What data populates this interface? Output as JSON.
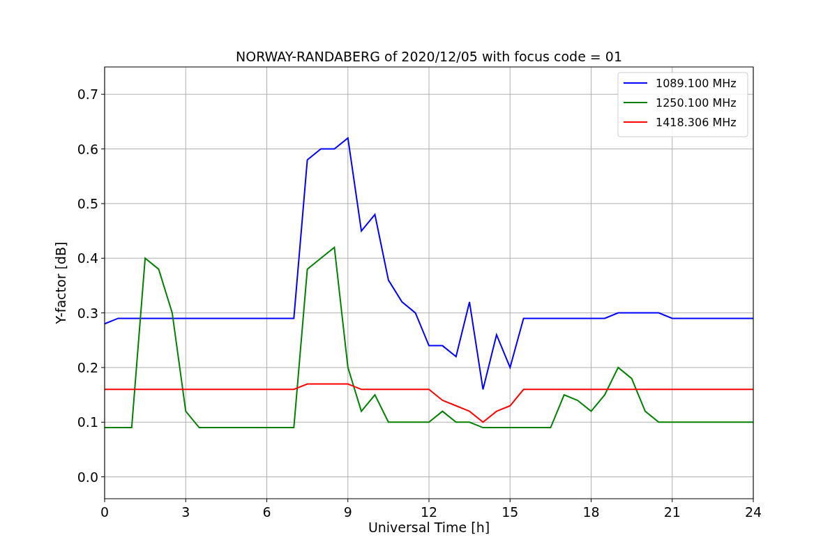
{
  "figure": {
    "chart_data": {
      "type": "line",
      "title": "NORWAY-RANDABERG of 2020/12/05 with focus code = 01",
      "xlabel": "Universal Time [h]",
      "ylabel": "Y-factor [dB]",
      "x": [
        0,
        0.5,
        1,
        1.5,
        2,
        2.5,
        3,
        3.5,
        4,
        4.5,
        5,
        5.5,
        6,
        6.5,
        7,
        7.5,
        8,
        8.5,
        9,
        9.5,
        10,
        10.5,
        11,
        11.5,
        12,
        12.5,
        13,
        13.5,
        14,
        14.5,
        15,
        15.5,
        16,
        16.5,
        17,
        17.5,
        18,
        18.5,
        19,
        19.5,
        20,
        20.5,
        21,
        21.5,
        22,
        22.5,
        23,
        23.5,
        24
      ],
      "series": [
        {
          "name": "1089.100 MHz",
          "color": "#0000ff",
          "values": [
            0.28,
            0.29,
            0.29,
            0.29,
            0.29,
            0.29,
            0.29,
            0.29,
            0.29,
            0.29,
            0.29,
            0.29,
            0.29,
            0.29,
            0.29,
            0.58,
            0.6,
            0.6,
            0.62,
            0.45,
            0.48,
            0.36,
            0.32,
            0.3,
            0.24,
            0.24,
            0.22,
            0.32,
            0.16,
            0.26,
            0.2,
            0.29,
            0.29,
            0.29,
            0.29,
            0.29,
            0.29,
            0.29,
            0.3,
            0.3,
            0.3,
            0.3,
            0.29,
            0.29,
            0.29,
            0.29,
            0.29,
            0.29,
            0.29
          ]
        },
        {
          "name": "1250.100 MHz",
          "color": "#008000",
          "values": [
            0.09,
            0.09,
            0.09,
            0.4,
            0.38,
            0.3,
            0.12,
            0.09,
            0.09,
            0.09,
            0.09,
            0.09,
            0.09,
            0.09,
            0.09,
            0.38,
            0.4,
            0.42,
            0.2,
            0.12,
            0.15,
            0.1,
            0.1,
            0.1,
            0.1,
            0.12,
            0.1,
            0.1,
            0.09,
            0.09,
            0.09,
            0.09,
            0.09,
            0.09,
            0.15,
            0.14,
            0.12,
            0.15,
            0.2,
            0.18,
            0.12,
            0.1,
            0.1,
            0.1,
            0.1,
            0.1,
            0.1,
            0.1,
            0.1
          ]
        },
        {
          "name": "1418.306 MHz",
          "color": "#ff0000",
          "values": [
            0.16,
            0.16,
            0.16,
            0.16,
            0.16,
            0.16,
            0.16,
            0.16,
            0.16,
            0.16,
            0.16,
            0.16,
            0.16,
            0.16,
            0.16,
            0.17,
            0.17,
            0.17,
            0.17,
            0.16,
            0.16,
            0.16,
            0.16,
            0.16,
            0.16,
            0.14,
            0.13,
            0.12,
            0.1,
            0.12,
            0.13,
            0.16,
            0.16,
            0.16,
            0.16,
            0.16,
            0.16,
            0.16,
            0.16,
            0.16,
            0.16,
            0.16,
            0.16,
            0.16,
            0.16,
            0.16,
            0.16,
            0.16,
            0.16
          ]
        }
      ],
      "grid": true,
      "legend": true,
      "xlim": [
        0,
        24
      ],
      "ylim": [
        -0.04,
        0.75
      ],
      "xticks": [
        0,
        3,
        6,
        9,
        12,
        15,
        18,
        21,
        24
      ],
      "yticks": [
        {
          "value": 0,
          "label": "0.0"
        },
        {
          "value": 0.1,
          "label": "0.1"
        },
        {
          "value": 0.2,
          "label": "0.2"
        },
        {
          "value": 0.3,
          "label": "0.3"
        },
        {
          "value": 0.4,
          "label": "0.4"
        },
        {
          "value": 0.5,
          "label": "0.5"
        },
        {
          "value": 0.6,
          "label": "0.6"
        },
        {
          "value": 0.7,
          "label": "0.7"
        }
      ]
    }
  }
}
